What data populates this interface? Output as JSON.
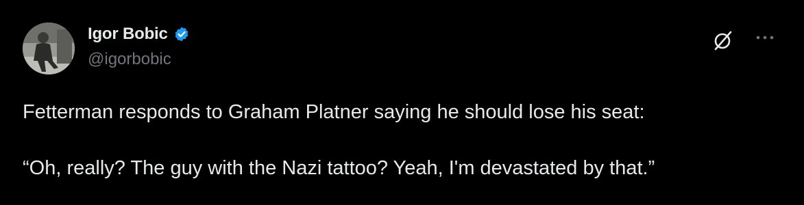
{
  "author": {
    "display_name": "Igor Bobic",
    "handle": "@igorbobic",
    "verified": true,
    "verified_color": "#1d9bf0"
  },
  "header_icons": [
    "grok-icon",
    "more-options-icon"
  ],
  "tweet": {
    "paragraphs": [
      "Fetterman responds to Graham Platner saying he should lose his seat:",
      "“Oh, really? The guy with the Nazi tattoo? Yeah, I'm devastated by that.”"
    ]
  },
  "colors": {
    "background": "#000000",
    "text": "#e7e9ea",
    "secondary_text": "#71767b"
  }
}
